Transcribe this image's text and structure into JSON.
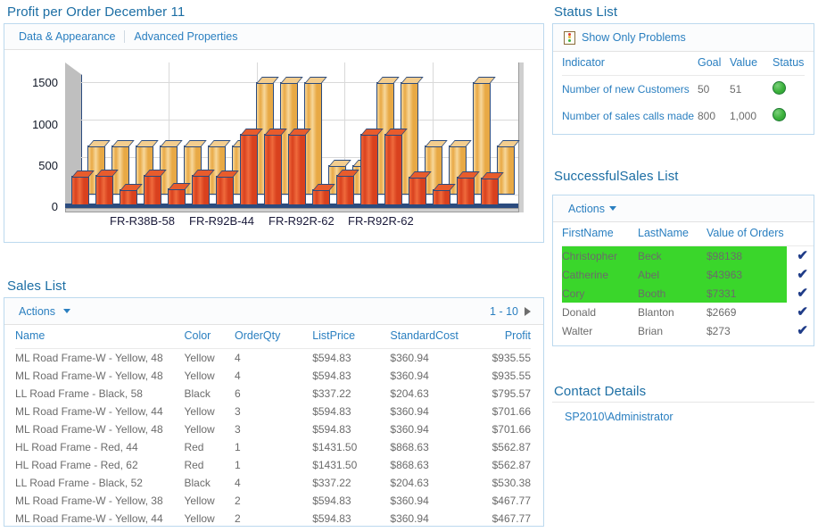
{
  "chart_webpart": {
    "title": "Profit per Order December 11",
    "tabs": [
      {
        "label": "Data & Appearance"
      },
      {
        "label": "Advanced Properties"
      }
    ]
  },
  "chart_data": {
    "type": "bar",
    "title": "Profit per Order December 11",
    "xlabel": "",
    "ylabel": "",
    "ylim": [
      0,
      1600
    ],
    "yticks": [
      0,
      500,
      1000,
      1500
    ],
    "grid": true,
    "legend": "none",
    "tick_labels": [
      "FR-R38B-58",
      "FR-R92B-44",
      "FR-R92R-62",
      "FR-R92R-62"
    ],
    "categories": [
      "1",
      "2",
      "3",
      "4",
      "5",
      "6",
      "7",
      "8",
      "9",
      "10",
      "11",
      "12",
      "13",
      "14",
      "15",
      "16",
      "17",
      "18"
    ],
    "series": [
      {
        "name": "Profit",
        "color": "#d9411e",
        "values": [
          360,
          370,
          200,
          370,
          205,
          370,
          360,
          880,
          880,
          880,
          200,
          370,
          880,
          880,
          350,
          195,
          350,
          340
        ]
      },
      {
        "name": "ListPrice",
        "color": "#f0c07a",
        "values": [
          660,
          660,
          660,
          660,
          660,
          660,
          660,
          1500,
          1500,
          1500,
          400,
          400,
          1500,
          1500,
          660,
          660,
          1500,
          660
        ]
      }
    ]
  },
  "status_webpart": {
    "title": "Status List",
    "toolbar": {
      "filter_label": "Show Only Problems",
      "icon": "kpi-traffic-light-icon"
    },
    "columns": [
      "Indicator",
      "Goal",
      "Value",
      "Status"
    ],
    "rows": [
      {
        "indicator": "Number of new Customers",
        "goal": "50",
        "value": "51",
        "status": "green"
      },
      {
        "indicator": "Number of sales calls made",
        "goal": "800",
        "value": "1,000",
        "status": "green"
      }
    ]
  },
  "successful_sales_webpart": {
    "title": "SuccessfulSales List",
    "actions_label": "Actions",
    "columns": [
      "FirstName",
      "LastName",
      "Value of Orders",
      ""
    ],
    "rows": [
      {
        "first": "Christopher",
        "last": "Beck",
        "value": "$98138",
        "check": "✔",
        "highlight": true
      },
      {
        "first": "Catherine",
        "last": "Abel",
        "value": "$43963",
        "check": "✔",
        "highlight": true
      },
      {
        "first": "Cory",
        "last": "Booth",
        "value": "$7331",
        "check": "✔",
        "highlight": true
      },
      {
        "first": "Donald",
        "last": "Blanton",
        "value": "$2669",
        "check": "✔",
        "highlight": false
      },
      {
        "first": "Walter",
        "last": "Brian",
        "value": "$273",
        "check": "✔",
        "highlight": false
      }
    ]
  },
  "contact_webpart": {
    "title": "Contact Details",
    "contact": "SP2010\\Administrator"
  },
  "sales_webpart": {
    "title": "Sales List",
    "actions_label": "Actions",
    "pager_label": "1 - 10",
    "columns": [
      "Name",
      "Color",
      "OrderQty",
      "ListPrice",
      "StandardCost",
      "Profit"
    ],
    "rows": [
      {
        "name": "ML Road Frame-W - Yellow, 48",
        "color": "Yellow",
        "qty": "4",
        "list": "$594.83",
        "cost": "$360.94",
        "profit": "$935.55"
      },
      {
        "name": "ML Road Frame-W - Yellow, 48",
        "color": "Yellow",
        "qty": "4",
        "list": "$594.83",
        "cost": "$360.94",
        "profit": "$935.55"
      },
      {
        "name": "LL Road Frame - Black, 58",
        "color": "Black",
        "qty": "6",
        "list": "$337.22",
        "cost": "$204.63",
        "profit": "$795.57"
      },
      {
        "name": "ML Road Frame-W - Yellow, 44",
        "color": "Yellow",
        "qty": "3",
        "list": "$594.83",
        "cost": "$360.94",
        "profit": "$701.66"
      },
      {
        "name": "ML Road Frame-W - Yellow, 48",
        "color": "Yellow",
        "qty": "3",
        "list": "$594.83",
        "cost": "$360.94",
        "profit": "$701.66"
      },
      {
        "name": "HL Road Frame - Red, 44",
        "color": "Red",
        "qty": "1",
        "list": "$1431.50",
        "cost": "$868.63",
        "profit": "$562.87"
      },
      {
        "name": "HL Road Frame - Red, 62",
        "color": "Red",
        "qty": "1",
        "list": "$1431.50",
        "cost": "$868.63",
        "profit": "$562.87"
      },
      {
        "name": "LL Road Frame - Black, 52",
        "color": "Black",
        "qty": "4",
        "list": "$337.22",
        "cost": "$204.63",
        "profit": "$530.38"
      },
      {
        "name": "ML Road Frame-W - Yellow, 38",
        "color": "Yellow",
        "qty": "2",
        "list": "$594.83",
        "cost": "$360.94",
        "profit": "$467.77"
      },
      {
        "name": "ML Road Frame-W - Yellow, 44",
        "color": "Yellow",
        "qty": "2",
        "list": "$594.83",
        "cost": "$360.94",
        "profit": "$467.77"
      }
    ]
  },
  "colors": {
    "accent_link": "#2a7fc0",
    "title": "#1c6ea4",
    "highlight_green": "#3ad62b",
    "status_green": "#3bb13b",
    "bar_front": "#d9411e",
    "bar_back": "#f0c07a",
    "bar_outline": "#2b4b7e"
  }
}
